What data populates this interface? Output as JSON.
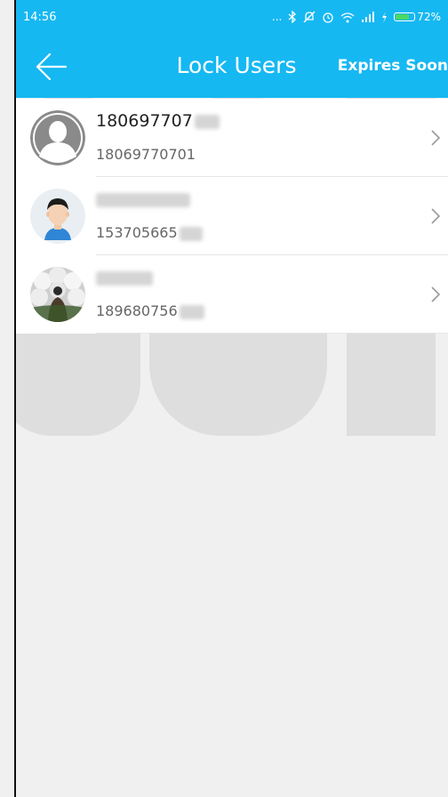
{
  "status_bar": {
    "time": "14:56",
    "signal_text": "...",
    "battery_percent": "72%",
    "battery_level": 0.72,
    "icons": [
      "bluetooth-icon",
      "mute-icon",
      "alarm-icon",
      "wifi-icon",
      "signal-icon",
      "charging-icon",
      "battery-icon"
    ]
  },
  "header": {
    "title": "Lock Users",
    "action_label": "Expires Soon",
    "background_color": "#16b8f2",
    "back_icon": "arrow-left-icon"
  },
  "users": [
    {
      "name": "180697707",
      "phone": "18069770701",
      "avatar": "default-avatar"
    },
    {
      "name": "",
      "phone": "153705665",
      "avatar": "cartoon-avatar"
    },
    {
      "name": "",
      "phone": "189680756",
      "avatar": "photo-avatar"
    }
  ]
}
